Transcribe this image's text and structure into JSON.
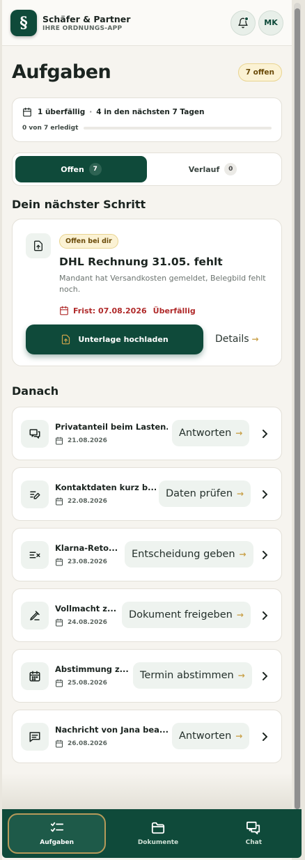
{
  "header": {
    "logo_glyph": "§",
    "brand_name": "Schäfer & Partner",
    "brand_sub": "IHRE ORDNUNGS-APP",
    "avatar_initials": "MK"
  },
  "page": {
    "title": "Aufgaben",
    "open_badge": "7 offen"
  },
  "summary": {
    "overdue": "1 überfällig",
    "separator": "·",
    "upcoming": "4 in den nächsten 7 Tagen",
    "done_text": "0 von 7 erledigt",
    "progress": 0
  },
  "tabs": [
    {
      "label": "Offen",
      "count": "7",
      "active": true
    },
    {
      "label": "Verlauf",
      "count": "0",
      "active": false
    }
  ],
  "next_step": {
    "section_title": "Dein nächster Schritt",
    "badge": "Offen bei dir",
    "title": "DHL Rechnung 31.05. fehlt",
    "description": "Mandant hat Versandkosten gemeldet, Belegbild fehlt noch.",
    "deadline": "Frist: 07.08.2026",
    "overdue": "Überfällig",
    "primary_label": "Unterlage hochladen",
    "details_label": "Details",
    "arrow": "→"
  },
  "later": {
    "section_title": "Danach",
    "items": [
      {
        "title": "Privatanteil beim Lasten...",
        "date": "21.08.2026",
        "action": "Antworten",
        "icon": "chat-icon"
      },
      {
        "title": "Kontaktdaten kurz b...",
        "date": "22.08.2026",
        "action": "Daten prüfen",
        "icon": "edit-icon"
      },
      {
        "title": "Klarna-Reto...",
        "date": "23.08.2026",
        "action": "Entscheidung geben",
        "icon": "decision-icon"
      },
      {
        "title": "Vollmacht z...",
        "date": "24.08.2026",
        "action": "Dokument freigeben",
        "icon": "sign-icon"
      },
      {
        "title": "Abstimmung z...",
        "date": "25.08.2026",
        "action": "Termin abstimmen",
        "icon": "calendar-grid-icon"
      },
      {
        "title": "Nachricht von Jana bea...",
        "date": "26.08.2026",
        "action": "Antworten",
        "icon": "message-icon"
      }
    ]
  },
  "nav": [
    {
      "label": "Aufgaben",
      "icon": "tasks-icon",
      "active": true
    },
    {
      "label": "Dokumente",
      "icon": "folder-icon",
      "active": false
    },
    {
      "label": "Chat",
      "icon": "chat-icon",
      "active": false
    }
  ],
  "colors": {
    "primary": "#0f4a3a",
    "accent": "#c9a14a",
    "danger": "#b02a2a",
    "badge_bg": "#fbf2d4"
  }
}
